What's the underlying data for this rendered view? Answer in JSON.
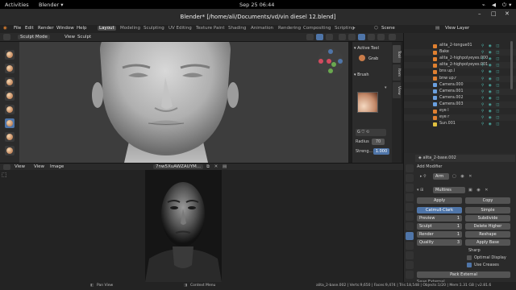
{
  "gnome": {
    "activities": "Activities",
    "app": "Blender ▾",
    "clock": "Sep 25  06:44"
  },
  "window": {
    "title": "Blender* [/home/ali/Documents/vd/vin diesel 12.blend]"
  },
  "menu": [
    "File",
    "Edit",
    "Render",
    "Window",
    "Help"
  ],
  "workspaces": [
    "Layout",
    "Modeling",
    "Sculpting",
    "UV Editing",
    "Texture Paint",
    "Shading",
    "Animation",
    "Rendering",
    "Compositing",
    "Scripting"
  ],
  "scene": "Scene",
  "view_layer": "View Layer",
  "viewport": {
    "mode": "Sculpt Mode",
    "menus": [
      "View",
      "Sculpt"
    ]
  },
  "tool_panel": {
    "active_tool": "Active Tool",
    "tool_name": "Grab",
    "brush": "Brush",
    "brush_letter": "G",
    "radius_label": "Radius",
    "radius_value": "70",
    "strength_label": "Streng...",
    "strength_value": "1.000"
  },
  "n_tabs": [
    "Tool",
    "Item",
    "View"
  ],
  "outliner": {
    "rows": [
      {
        "name": "alita_2-tongue01",
        "icon_color": "#e08030"
      },
      {
        "name": "Bake",
        "icon_color": "#e08030"
      },
      {
        "name": "alita_2-highpolyeyes.000",
        "icon_color": "#e08030"
      },
      {
        "name": "alita_2-highpolyeyes.001",
        "icon_color": "#e08030"
      },
      {
        "name": "bns up.l",
        "icon_color": "#e08030"
      },
      {
        "name": "bnw up.r",
        "icon_color": "#e08030"
      },
      {
        "name": "Camera.000",
        "icon_color": "#6aa0e0"
      },
      {
        "name": "Camera.001",
        "icon_color": "#6aa0e0"
      },
      {
        "name": "Camera.002",
        "icon_color": "#6aa0e0"
      },
      {
        "name": "Camera.003",
        "icon_color": "#6aa0e0"
      },
      {
        "name": "eye l",
        "icon_color": "#e08030"
      },
      {
        "name": "eye r",
        "icon_color": "#e08030"
      },
      {
        "name": "Sun.001",
        "icon_color": "#e0c040"
      }
    ]
  },
  "properties": {
    "object": "alita_2-base.002",
    "add_modifier": "Add Modifier",
    "arm": "Arm",
    "modifier_name": "Multires",
    "apply": "Apply",
    "copy": "Copy",
    "catmull_clark": "Catmull-Clark",
    "simple": "Simple",
    "preview_label": "Preview",
    "preview_value": "1",
    "sculpt_label": "Sculpt",
    "sculpt_value": "1",
    "render_label": "Render",
    "render_value": "1",
    "quality_label": "Quality",
    "quality_value": "3",
    "subdivide": "Subdivide",
    "delete_higher": "Delete Higher",
    "reshape": "Reshape",
    "apply_base": "Apply Base",
    "sharp": "Sharp",
    "optimal_display": "Optimal Display",
    "use_creases": "Use Creases",
    "pack_external": "Pack External",
    "save_external": "Save External..."
  },
  "image_editor": {
    "menus": [
      "View",
      "View",
      "Image"
    ],
    "image_name": "7nw5XuAWZAUYM..."
  },
  "status": {
    "left": "Pan View",
    "middle": "Context Menu",
    "right": "alita_2-base.002 | Verts:9,650 | Faces:9,474 | Tris:18,548 | Objects:1/20 | Mem:1.31 GB | v2.81.6"
  },
  "colors": {
    "accent": "#4f75a8",
    "bg": "#1d1d1d",
    "panel": "#2a2a2a"
  }
}
